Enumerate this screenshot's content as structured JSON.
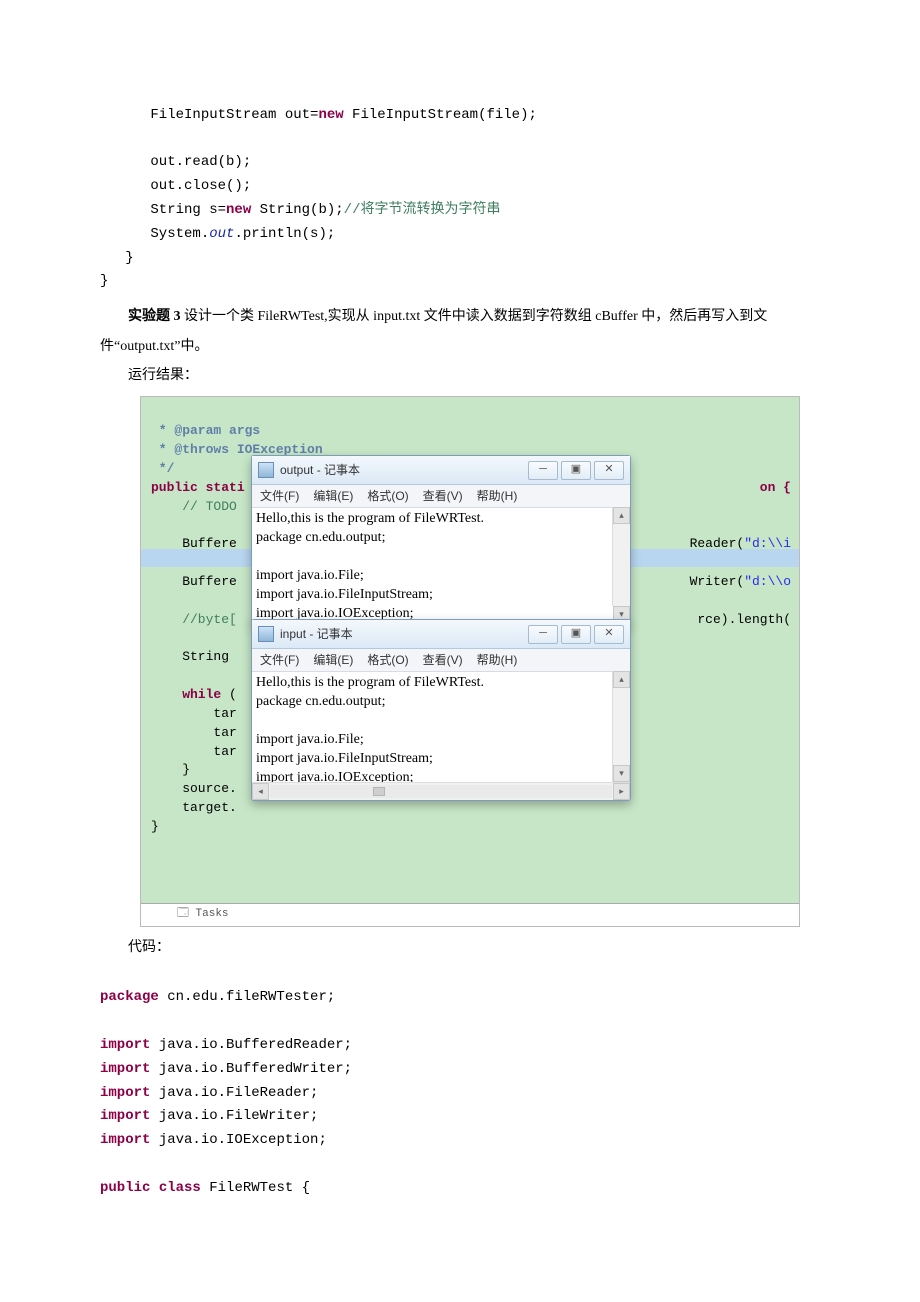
{
  "topcode": {
    "l1a": "      FileInputStream out=",
    "l1b": "new",
    "l1c": " FileInputStream(file);",
    "l2": "",
    "l3": "      out.read(b);",
    "l4": "      out.close();",
    "l5a": "      String s=",
    "l5b": "new",
    "l5c": " String(b);",
    "l5d": "//将字节流转换为字符串",
    "l6a": "      System.",
    "l6b": "out",
    "l6c": ".println(s);",
    "l7": "   }",
    "l8": "}"
  },
  "para1a": "实验题 3",
  "para1b": " 设计一个类 FileRWTest,实现从 input.txt 文件中读入数据到字符数组 cBuffer 中，然后再写入到文件“output.txt”中。",
  "para2": "运行结果：",
  "ide": {
    "c1": " * @param args",
    "c2": " * @throws IOException",
    "c3": " */",
    "fn1a": "public",
    "fn1b": " stati",
    "fn1c": "on {",
    "todo": "    // TODO",
    "bf1": "    Buffere",
    "bf1r": "Reader(\"d:\\\\i",
    "bf2": "    Buffere",
    "bf2r": "Writer(\"d:\\\\o",
    "byte": "    //byte[",
    "byteR": "rce).length(",
    "str": "    String",
    "wh": "    while (",
    "t1": "        tar",
    "t2": "        tar",
    "t3": "        tar",
    "cb": "    }",
    "src": "    source.",
    "tgt": "    target.",
    "end": "}",
    "tab1": "",
    "tab2": "Tasks"
  },
  "np_output": {
    "title": "output - 记事本",
    "menu": [
      "文件(F)",
      "编辑(E)",
      "格式(O)",
      "查看(V)",
      "帮助(H)"
    ],
    "body": "Hello,this is the program of FileWRTest.\npackage cn.edu.output;\n\nimport java.io.File;\nimport java.io.FileInputStream;\nimport java.io.IOException;"
  },
  "np_input": {
    "title": "input - 记事本",
    "menu": [
      "文件(F)",
      "编辑(E)",
      "格式(O)",
      "查看(V)",
      "帮助(H)"
    ],
    "body": "Hello,this is the program of FileWRTest.\npackage cn.edu.output;\n\nimport java.io.File;\nimport java.io.FileInputStream;\nimport java.io.IOException;"
  },
  "para3": "代码：",
  "bottomcode": {
    "pkg_kw": "package",
    "pkg": " cn.edu.fileRWTester;",
    "imp": "import",
    "i1": " java.io.BufferedReader;",
    "i2": " java.io.BufferedWriter;",
    "i3": " java.io.FileReader;",
    "i4": " java.io.FileWriter;",
    "i5": " java.io.IOException;",
    "pc1": "public",
    "pc2": " class",
    "pc3": " FileRWTest {"
  },
  "winctrl": {
    "min": "─",
    "max": "▣",
    "close": "✕"
  }
}
